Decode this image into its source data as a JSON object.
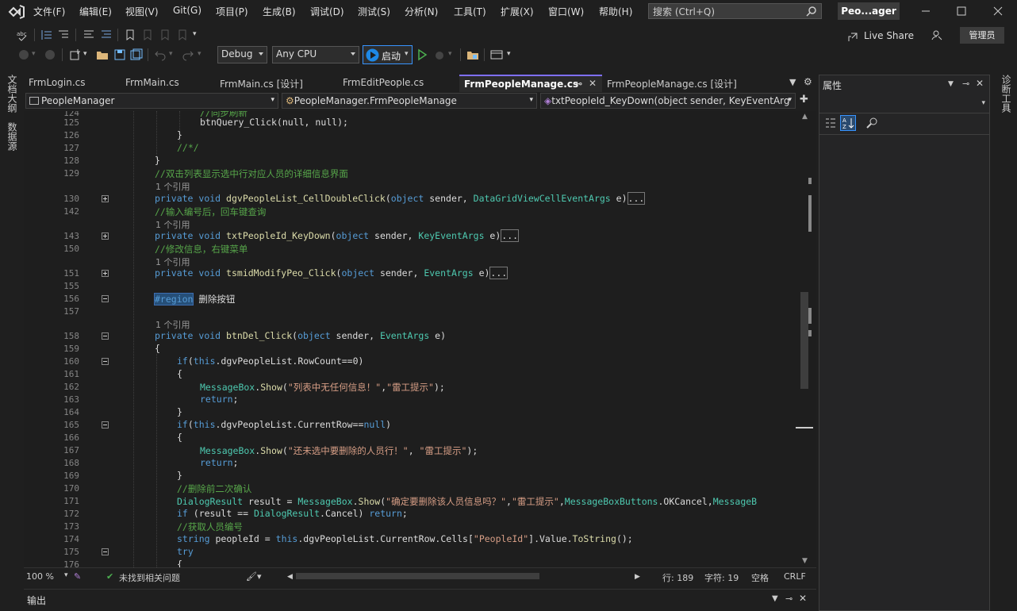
{
  "menu": [
    "文件(F)",
    "编辑(E)",
    "视图(V)",
    "Git(G)",
    "项目(P)",
    "生成(B)",
    "调试(D)",
    "测试(S)",
    "分析(N)",
    "工具(T)",
    "扩展(X)",
    "窗口(W)",
    "帮助(H)"
  ],
  "search": {
    "placeholder": "搜索 (Ctrl+Q)"
  },
  "solution_name": "Peo...ager",
  "toolbar": {
    "config": "Debug",
    "platform": "Any CPU",
    "start_label": "启动",
    "live_share": "Live Share",
    "admin": "管理员"
  },
  "left_sidebar": [
    "文档大纲",
    "数据源"
  ],
  "right_sidebar": [
    "诊断工具"
  ],
  "tabs": [
    {
      "label": "FrmLogin.cs"
    },
    {
      "label": "FrmMain.cs"
    },
    {
      "label": "FrmMain.cs [设计]"
    },
    {
      "label": "FrmEditPeople.cs"
    },
    {
      "label": "FrmPeopleManage.cs",
      "active": true
    },
    {
      "label": "FrmPeopleManage.cs [设计]"
    }
  ],
  "nav": {
    "project": "PeopleManager",
    "class": "PeopleManager.FrmPeopleManage",
    "member": "txtPeopleId_KeyDown(object sender, KeyEventArg"
  },
  "code_lines": [
    {
      "n": "124",
      "html": "<span class=\"cm\">//同步刷新</span>",
      "indent": 3
    },
    {
      "n": "125",
      "text": "btnQuery_Click(null, null);",
      "indent": 3
    },
    {
      "n": "126",
      "text": "}",
      "indent": 2
    },
    {
      "n": "127",
      "html": "<span class=\"cm\">//*/</span>",
      "indent": 2
    },
    {
      "n": "128",
      "text": "}",
      "indent": 1
    },
    {
      "n": "129",
      "html": "<span class=\"cm\">//双击列表显示选中行对应人员的详细信息界面</span>",
      "indent": 1
    }
  ],
  "status": {
    "zoom": "100 %",
    "issues": "未找到相关问题",
    "line": "行: 189",
    "char": "字符: 19",
    "space": "空格",
    "eol": "CRLF"
  },
  "output_title": "输出",
  "properties_title": "属性",
  "ref_label": "1 个引用"
}
